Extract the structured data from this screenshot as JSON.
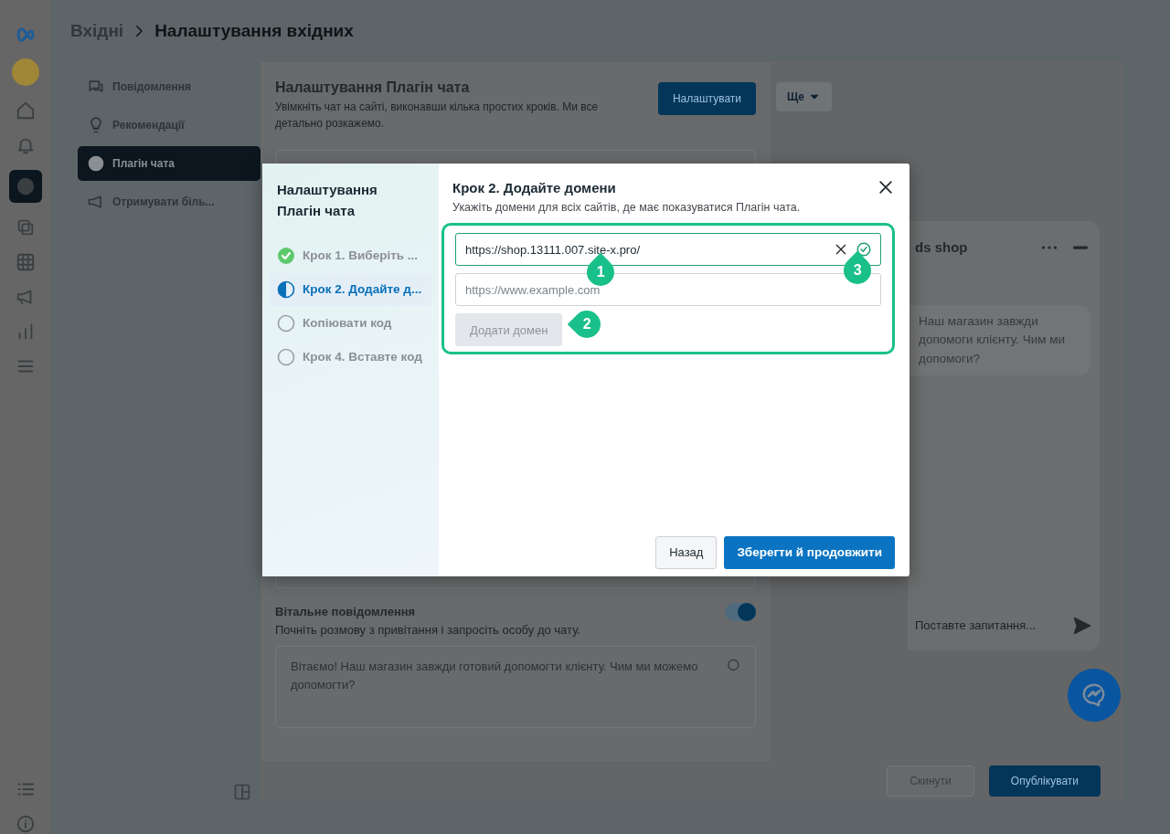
{
  "breadcrumb": [
    {
      "label": "Вхідні",
      "current": false
    },
    {
      "label": "Налаштування вхідних",
      "current": true
    }
  ],
  "settings_menu": [
    {
      "label": "Повідомлення",
      "selected": false
    },
    {
      "label": "Рекомендації",
      "selected": false
    },
    {
      "label": "Плагін чата",
      "selected": true
    },
    {
      "label": "Отримувати біль...",
      "selected": false
    }
  ],
  "panel": {
    "title": "Налаштування Плагін чата",
    "description": "Увімкніть чат на сайті, виконавши кілька простих кроків. Ми все детально розкажемо.",
    "button": "Налаштувати"
  },
  "more_button": "Ще",
  "welcome": {
    "title": "Вітальне повідомлення",
    "description": "Почніть розмову з привітання і запросіть особу до чату.",
    "on": true,
    "message": "Вітаємо! Наш магазин завжди готовий допомогти клієнту. Чим ми можемо допомогти?"
  },
  "chat_preview": {
    "name": "ds shop",
    "message_lines": [
      "Наш магазин завжди",
      "допомоги клієнту. Чим ми",
      "допомоги?"
    ],
    "placeholder": "Поставте запитання..."
  },
  "footer_buttons": [
    {
      "label": "Скинути",
      "primary": false
    },
    {
      "label": "Опублікувати",
      "primary": true
    }
  ],
  "modal": {
    "sidebar_title": "Налаштування Плагін чата",
    "steps": [
      {
        "label": "Крок 1. Виберіть ...",
        "kind": "done",
        "selected": false
      },
      {
        "label": "Крок 2. Додайте д...",
        "kind": "current",
        "selected": true
      },
      {
        "label": "Копіювати код",
        "kind": "todo",
        "selected": false
      },
      {
        "label": "Крок 4. Вставте код",
        "kind": "todo",
        "selected": false
      }
    ],
    "title": "Крок 2. Додайте домени",
    "description": "Укажіть домени для всіх сайтів, де має показуватися Плагін чата.",
    "domains": [
      {
        "value": "https://shop.13111.007.site-x.pro/",
        "valid": true
      }
    ],
    "new_domain": {
      "placeholder": "https://www.example.com"
    },
    "add_button": {
      "label": "Додати домен",
      "disabled": true
    },
    "back_button": "Назад",
    "save_button": "Зберегти й продовжити"
  },
  "annotations": [
    {
      "label": "1"
    },
    {
      "label": "2"
    },
    {
      "label": "3"
    }
  ]
}
